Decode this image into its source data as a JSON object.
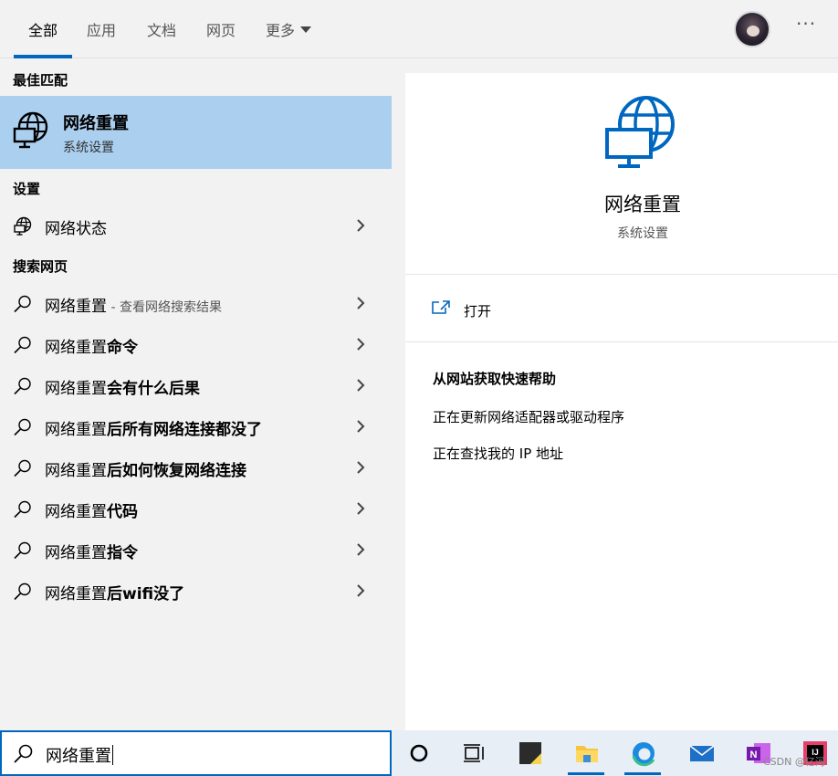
{
  "tabs": [
    {
      "label": "全部"
    },
    {
      "label": "应用"
    },
    {
      "label": "文档"
    },
    {
      "label": "网页"
    },
    {
      "label": "更多"
    }
  ],
  "more_dots": "···",
  "best_match": {
    "heading": "最佳匹配",
    "title": "网络重置",
    "subtitle": "系统设置"
  },
  "settings": {
    "heading": "设置",
    "items": [
      {
        "label": "网络状态"
      }
    ]
  },
  "web": {
    "heading": "搜索网页",
    "items": [
      {
        "prefix": "网络重置",
        "bold": "",
        "hint": " - 查看网络搜索结果"
      },
      {
        "prefix": "网络重置",
        "bold": "命令",
        "hint": ""
      },
      {
        "prefix": "网络重置",
        "bold": "会有什么后果",
        "hint": ""
      },
      {
        "prefix": "网络重置",
        "bold": "后所有网络连接都没了",
        "hint": ""
      },
      {
        "prefix": "网络重置",
        "bold": "后如何恢复网络连接",
        "hint": ""
      },
      {
        "prefix": "网络重置",
        "bold": "代码",
        "hint": ""
      },
      {
        "prefix": "网络重置",
        "bold": "指令",
        "hint": ""
      },
      {
        "prefix": "网络重置",
        "bold": "后wifi没了",
        "hint": ""
      }
    ]
  },
  "preview": {
    "title": "网络重置",
    "subtitle": "系统设置",
    "open_label": "打开",
    "help_heading": "从网站获取快速帮助",
    "help_links": [
      {
        "label": "正在更新网络适配器或驱动程序"
      },
      {
        "label": "正在查找我的 IP 地址"
      }
    ]
  },
  "search": {
    "value": "网络重置"
  },
  "taskbar": {
    "icons": [
      "cortana-icon",
      "task-view-icon",
      "sticky-notes-icon",
      "file-explorer-icon",
      "edge-icon",
      "mail-icon",
      "onenote-icon",
      "intellij-icon"
    ],
    "onenote_letter": "N",
    "intellij_letters": "IJ"
  },
  "watermark": "CSDN @亿河",
  "colors": {
    "accent": "#0067c0",
    "selected_bg": "#aacfef"
  }
}
